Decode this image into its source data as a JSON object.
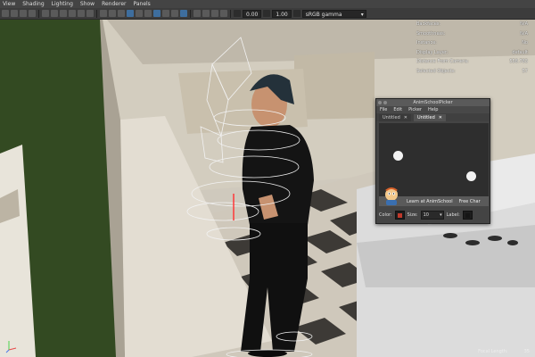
{
  "menubar": {
    "items": [
      "View",
      "Shading",
      "Lighting",
      "Show",
      "Renderer",
      "Panels"
    ]
  },
  "toolbar": {
    "exposure": "0.00",
    "gamma": "1.00",
    "color_space": "sRGB gamma"
  },
  "hud": {
    "rows": [
      {
        "label": "Backfaces:",
        "value": "N/A"
      },
      {
        "label": "Smoothness:",
        "value": "N/A"
      },
      {
        "label": "Instance:",
        "value": "No"
      },
      {
        "label": "Display Layer:",
        "value": "default"
      },
      {
        "label": "Distance From Camera:",
        "value": "558.783"
      },
      {
        "label": "Selected Objects:",
        "value": "57"
      }
    ],
    "focal_label": "Focal Length:",
    "focal_value": "35"
  },
  "picker": {
    "title": "AnimSchoolPicker",
    "menu": [
      "File",
      "Edit",
      "Picker",
      "Help"
    ],
    "tabs": [
      {
        "label": "Untitled",
        "close": "✕",
        "active": false
      },
      {
        "label": "Untitled",
        "close": "✕",
        "active": true
      }
    ],
    "banner": {
      "learn": "Learn at AnimSchool",
      "free": "Free Char"
    },
    "bottom": {
      "color_label": "Color:",
      "color_value": "#c0392b",
      "size_label": "Size:",
      "size_value": "10",
      "label_label": "Label:"
    }
  },
  "icons": {
    "axis": "axis-gizmo-icon",
    "logo": "animschool-mascot-icon"
  }
}
